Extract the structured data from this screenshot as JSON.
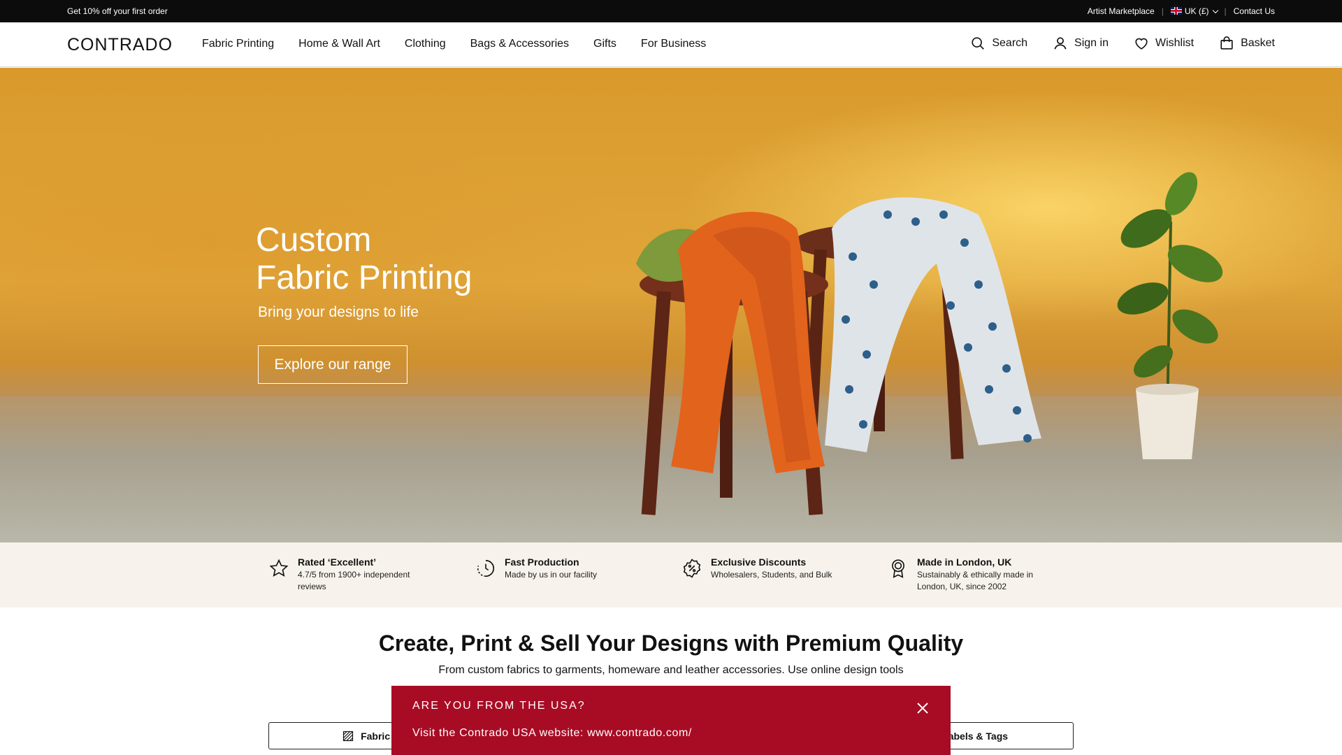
{
  "promo": {
    "offer": "Get 10% off your first order",
    "artist_marketplace": "Artist Marketplace",
    "region": "UK (£)",
    "contact": "Contact Us"
  },
  "header": {
    "logo": "CONTRADO",
    "nav": [
      "Fabric Printing",
      "Home & Wall Art",
      "Clothing",
      "Bags & Accessories",
      "Gifts",
      "For Business"
    ],
    "search": "Search",
    "sign_in": "Sign in",
    "wishlist": "Wishlist",
    "basket": "Basket"
  },
  "hero": {
    "title_line1": "Custom",
    "title_line2": "Fabric Printing",
    "subtitle": "Bring your designs to life",
    "cta": "Explore our range"
  },
  "usps": [
    {
      "title": "Rated ‘Excellent’",
      "desc_line1": "4.7/5 from 1900+ independent",
      "desc_line2": "reviews",
      "icon": "star-icon"
    },
    {
      "title": "Fast Production",
      "desc_line1": "Made by us in our facility",
      "desc_line2": "",
      "icon": "clock-icon"
    },
    {
      "title": "Exclusive Discounts",
      "desc_line1": "Wholesalers, Students, and Bulk",
      "desc_line2": "",
      "icon": "percent-badge-icon"
    },
    {
      "title": "Made in London, UK",
      "desc_line1": "Sustainably & ethically made in",
      "desc_line2": "London, UK, since 2002",
      "icon": "award-icon"
    }
  ],
  "main": {
    "title": "Create, Print & Sell Your Designs with Premium Quality",
    "desc_line1": "From custom fabrics to garments, homeware and leather accessories. Use online design tools",
    "pill_left": "Fabric Print",
    "pill_right": "rand Labels & Tags"
  },
  "usa_popup": {
    "title": "ARE YOU FROM THE USA?",
    "link": "Visit the Contrado USA website: www.contrado.com/"
  },
  "colors": {
    "promo_bg": "#0c0c0c",
    "usp_bg": "#f7f3ec",
    "popup_bg": "#a80c24"
  }
}
